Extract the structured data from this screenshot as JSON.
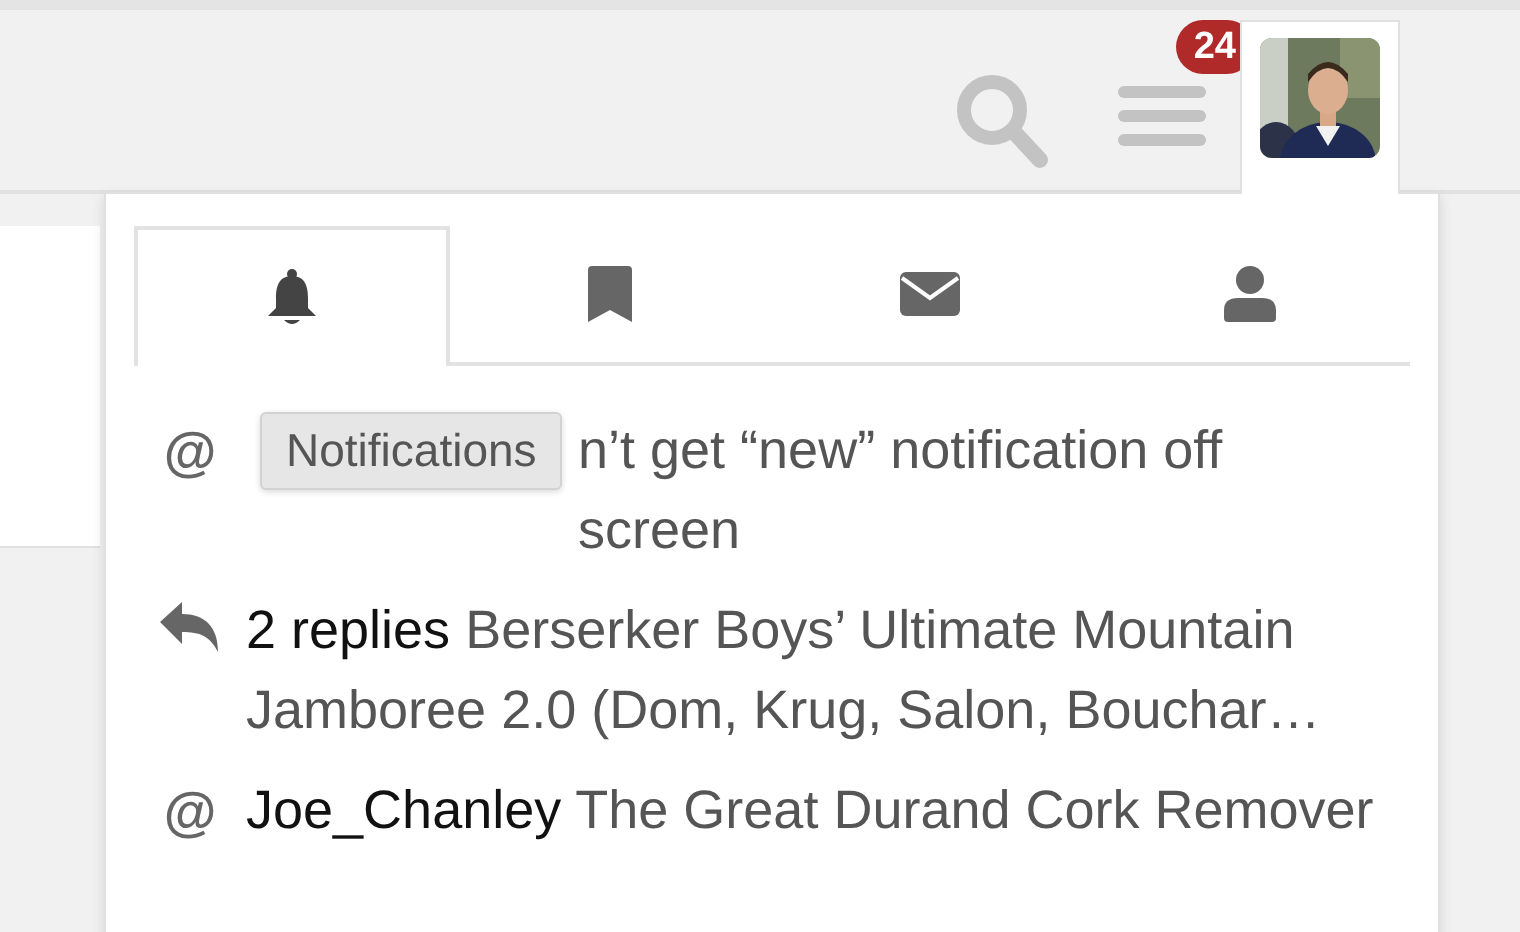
{
  "header": {
    "badge": "24"
  },
  "tabs": [
    {
      "selected": true
    },
    {
      "selected": false
    },
    {
      "selected": false
    },
    {
      "selected": false
    }
  ],
  "tooltip": {
    "text": "Notifications"
  },
  "notifications": [
    {
      "kind": "mention",
      "symbol": "@",
      "title": "n’t get “new” notification off screen"
    },
    {
      "kind": "reply",
      "user": "2 replies",
      "title": "Berserker Boys’ Ultimate Mountain Jamboree 2.0 (Dom, Krug, Salon, Bouchar…"
    },
    {
      "kind": "mention",
      "symbol": "@",
      "user": "Joe_Chanley",
      "title": "The Great Durand Cork Remover"
    }
  ]
}
